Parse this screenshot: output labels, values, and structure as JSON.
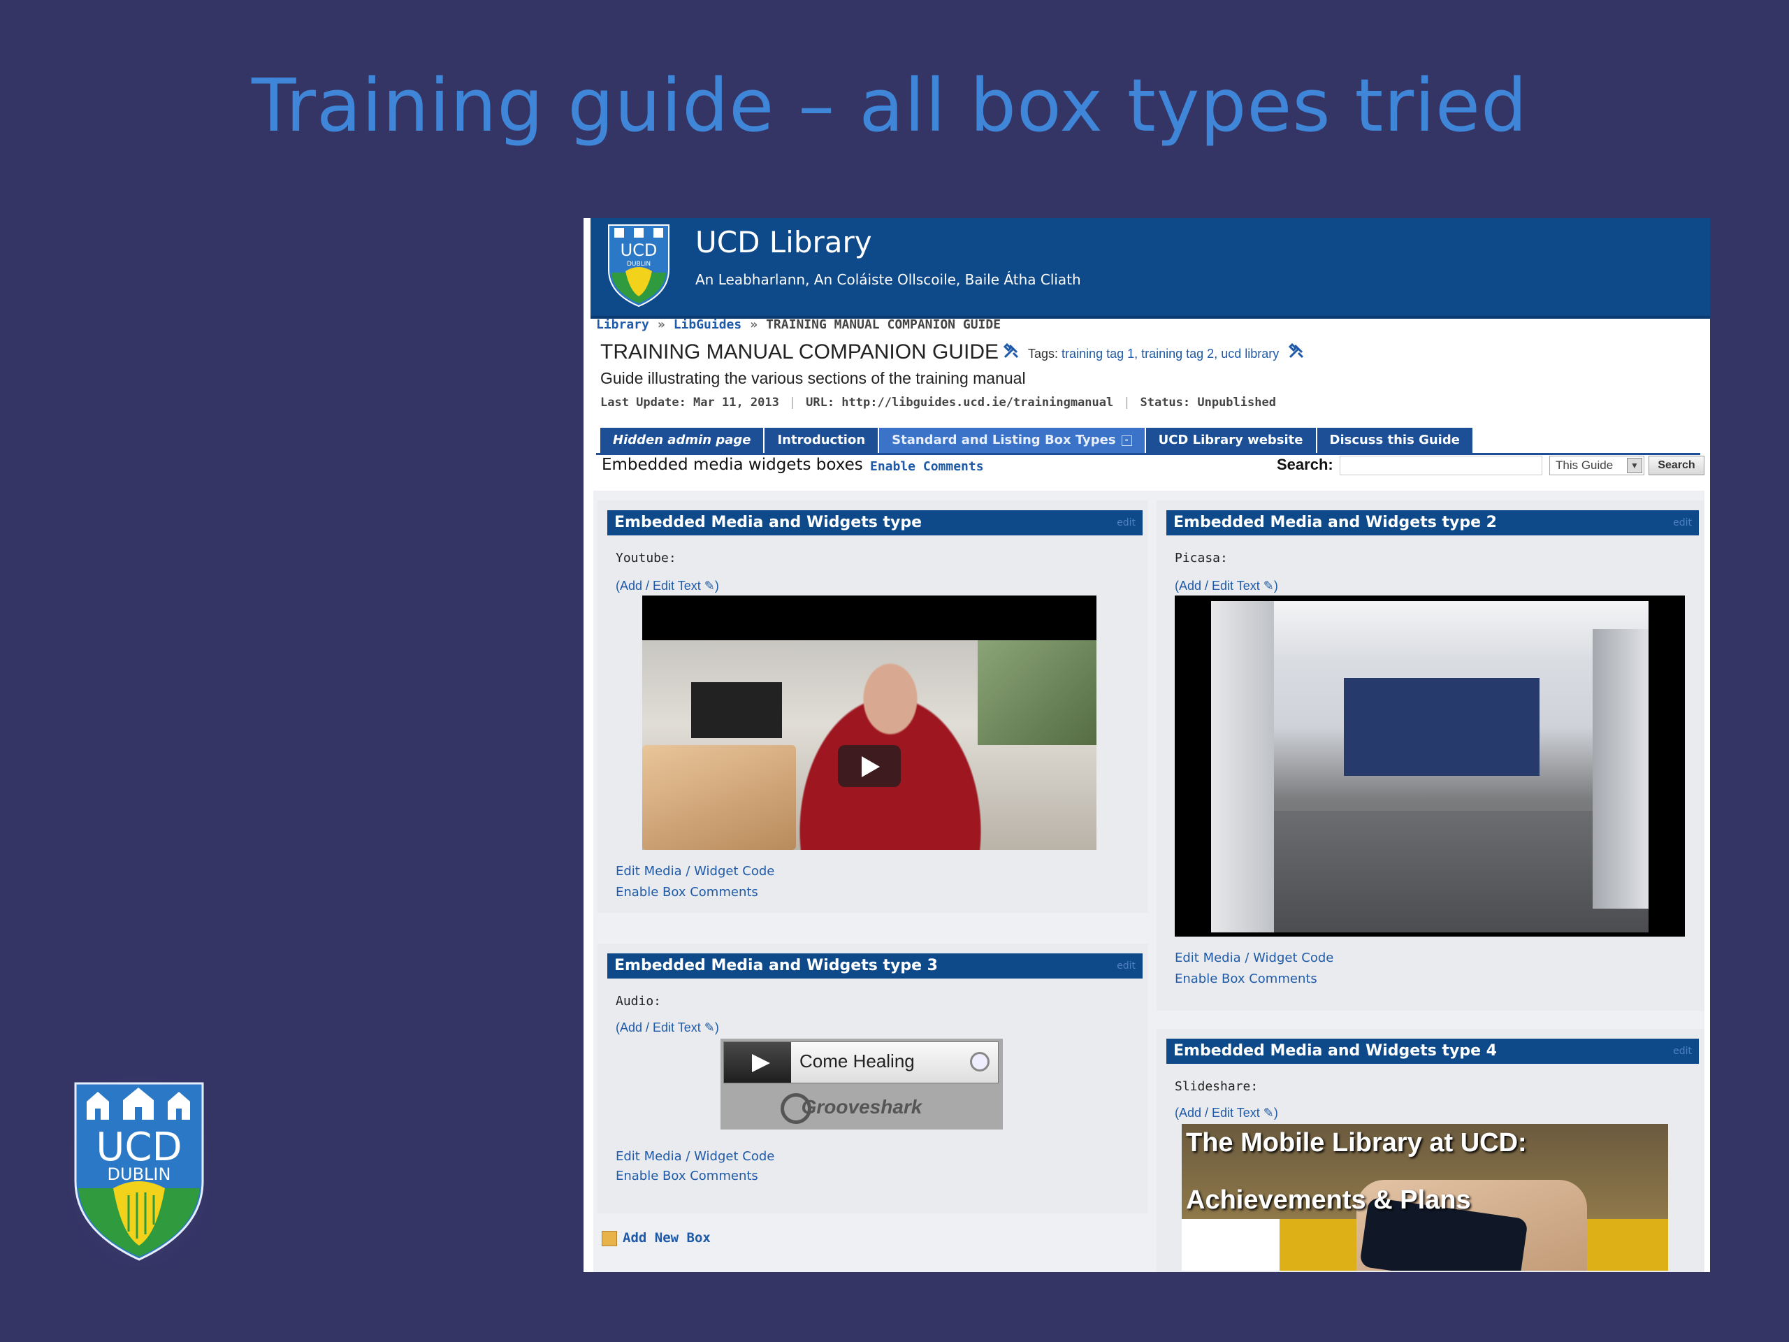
{
  "slide": {
    "title": "Training guide – all box types tried"
  },
  "banner": {
    "title": "UCD Library",
    "subtitle": "An Leabharlann, An Coláiste Ollscoile, Baile Átha Cliath",
    "crest_text": "UCD",
    "crest_subtext": "DUBLIN"
  },
  "breadcrumb": [
    "Library",
    "LibGuides",
    "TRAINING MANUAL COMPANION GUIDE"
  ],
  "breadcrumb_sep": "»",
  "guide": {
    "title": "TRAINING MANUAL COMPANION GUIDE",
    "tags_label": "Tags:",
    "tags": "training tag 1, training tag 2, ucd library",
    "description": "Guide illustrating the various sections of the training manual",
    "last_update": "Last Update: Mar 11, 2013",
    "url": "URL: http://libguides.ucd.ie/trainingmanual",
    "status": "Status: Unpublished"
  },
  "tabs": [
    {
      "label": "Hidden admin page"
    },
    {
      "label": "Introduction"
    },
    {
      "label": "Standard and Listing Box Types",
      "toggle": "-"
    },
    {
      "label": "UCD Library website"
    },
    {
      "label": "Discuss this Guide"
    }
  ],
  "page": {
    "name": "Embedded media widgets boxes",
    "enable_comments": "Enable Comments",
    "search_label": "Search:",
    "search_value": "",
    "search_scope": "This Guide",
    "search_button": "Search"
  },
  "boxes": [
    {
      "title": "Embedded Media and Widgets type",
      "edit": "edit",
      "label": "Youtube:",
      "add_edit": "(Add / Edit Text",
      "edit_media": "Edit Media / Widget Code",
      "enable_box_comments": "Enable Box Comments"
    },
    {
      "title": "Embedded Media and Widgets type 2",
      "edit": "edit",
      "label": "Picasa:",
      "add_edit": "(Add / Edit Text",
      "edit_media": "Edit Media / Widget Code",
      "enable_box_comments": "Enable Box Comments"
    },
    {
      "title": "Embedded Media and Widgets type 3",
      "edit": "edit",
      "label": "Audio:",
      "add_edit": "(Add / Edit Text",
      "edit_media": "Edit Media / Widget Code",
      "enable_box_comments": "Enable Box Comments"
    },
    {
      "title": "Embedded Media and Widgets type 4",
      "edit": "edit",
      "label": "Slideshare:",
      "add_edit": "(Add / Edit Text"
    }
  ],
  "audio": {
    "track": "Come Healing",
    "brand": "Grooveshark"
  },
  "slideshare": {
    "line1": "The Mobile Library at UCD:",
    "line2": "Achievements & Plans"
  },
  "add_new_box": "Add New Box",
  "logo": {
    "text": "UCD",
    "subtext": "DUBLIN"
  },
  "colors": {
    "slide_bg": "#343465",
    "title": "#3f86d8",
    "banner": "#0e4a8a",
    "tab": "#1c4f96",
    "link": "#1f5aa8"
  }
}
